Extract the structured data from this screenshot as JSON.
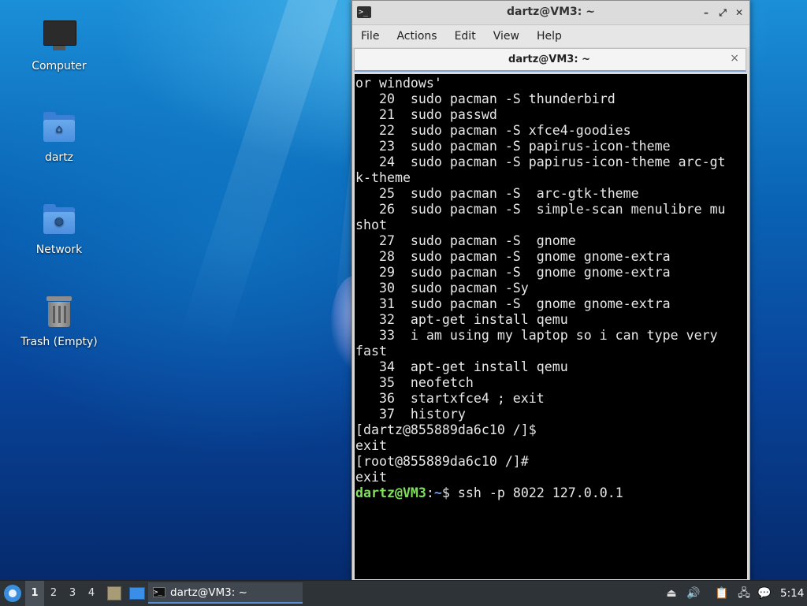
{
  "desktop": {
    "icons": [
      {
        "label": "Computer",
        "icon": "computer-icon"
      },
      {
        "label": "dartz",
        "icon": "home-folder-icon"
      },
      {
        "label": "Network",
        "icon": "network-folder-icon"
      },
      {
        "label": "Trash (Empty)",
        "icon": "trash-icon"
      }
    ]
  },
  "window": {
    "title": "dartz@VM3: ~",
    "app_icon_glyph": ">_",
    "minimize_glyph": "–",
    "maximize_glyph": "⤢",
    "close_glyph": "✕",
    "menu": [
      "File",
      "Actions",
      "Edit",
      "View",
      "Help"
    ],
    "tab": {
      "title": "dartz@VM3: ~",
      "close_glyph": "×"
    }
  },
  "terminal": {
    "lines": [
      "or windows'",
      "   20  sudo pacman -S thunderbird",
      "   21  sudo passwd",
      "   22  sudo pacman -S xfce4-goodies",
      "   23  sudo pacman -S papirus-icon-theme",
      "   24  sudo pacman -S papirus-icon-theme arc-gt",
      "k-theme",
      "   25  sudo pacman -S  arc-gtk-theme",
      "   26  sudo pacman -S  simple-scan menulibre mu",
      "shot",
      "   27  sudo pacman -S  gnome",
      "   28  sudo pacman -S  gnome gnome-extra",
      "   29  sudo pacman -S  gnome gnome-extra",
      "   30  sudo pacman -Sy",
      "   31  sudo pacman -S  gnome gnome-extra",
      "   32  apt-get install qemu",
      "   33  i am using my laptop so i can type very",
      "fast",
      "   34  apt-get install qemu",
      "   35  neofetch",
      "   36  startxfce4 ; exit",
      "   37  history",
      "[dartz@855889da6c10 /]$",
      "exit",
      "[root@855889da6c10 /]#",
      "exit"
    ],
    "prompt": {
      "user_host": "dartz@VM3",
      "colon": ":",
      "path": "~",
      "symbol": "$",
      "command": " ssh -p 8022 127.0.0.1"
    }
  },
  "taskbar": {
    "workspaces": [
      "1",
      "2",
      "3",
      "4"
    ],
    "active_workspace": "1",
    "task": {
      "label": "dartz@VM3: ~",
      "icon_glyph": ">_"
    },
    "clock": "5:14",
    "colors": {
      "bg": "#2e3338",
      "accent": "#5a8fd0"
    }
  }
}
